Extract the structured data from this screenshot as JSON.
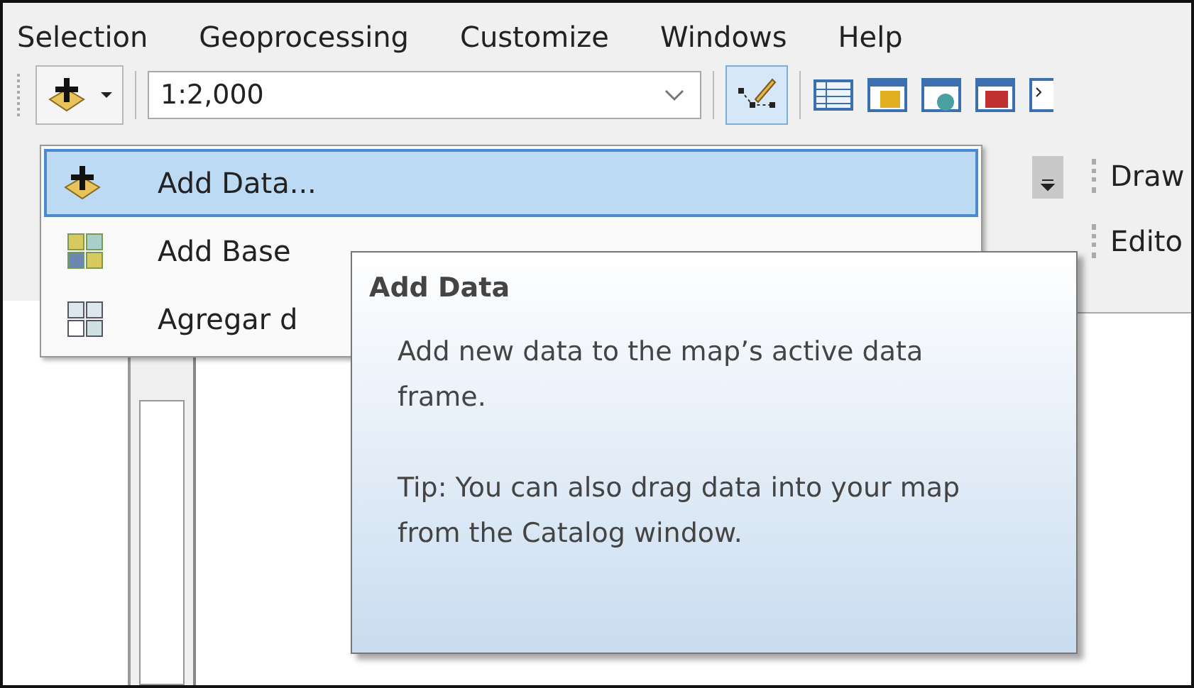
{
  "menubar": [
    "Selection",
    "Geoprocessing",
    "Customize",
    "Windows",
    "Help"
  ],
  "toolbar": {
    "scale": "1:2,000"
  },
  "dropdown": {
    "items": [
      {
        "label": "Add Data...",
        "kind": "add",
        "selected": true
      },
      {
        "label": "Add Base",
        "kind": "basemap",
        "selected": false
      },
      {
        "label": "Agregar d",
        "kind": "grid",
        "selected": false
      }
    ]
  },
  "tooltip": {
    "title": "Add Data",
    "description": "Add new data to the map’s active data frame.",
    "tip": "Tip: You can also drag data into your map from the Catalog window."
  },
  "right_toolbars": [
    "Draw",
    "Edito"
  ]
}
